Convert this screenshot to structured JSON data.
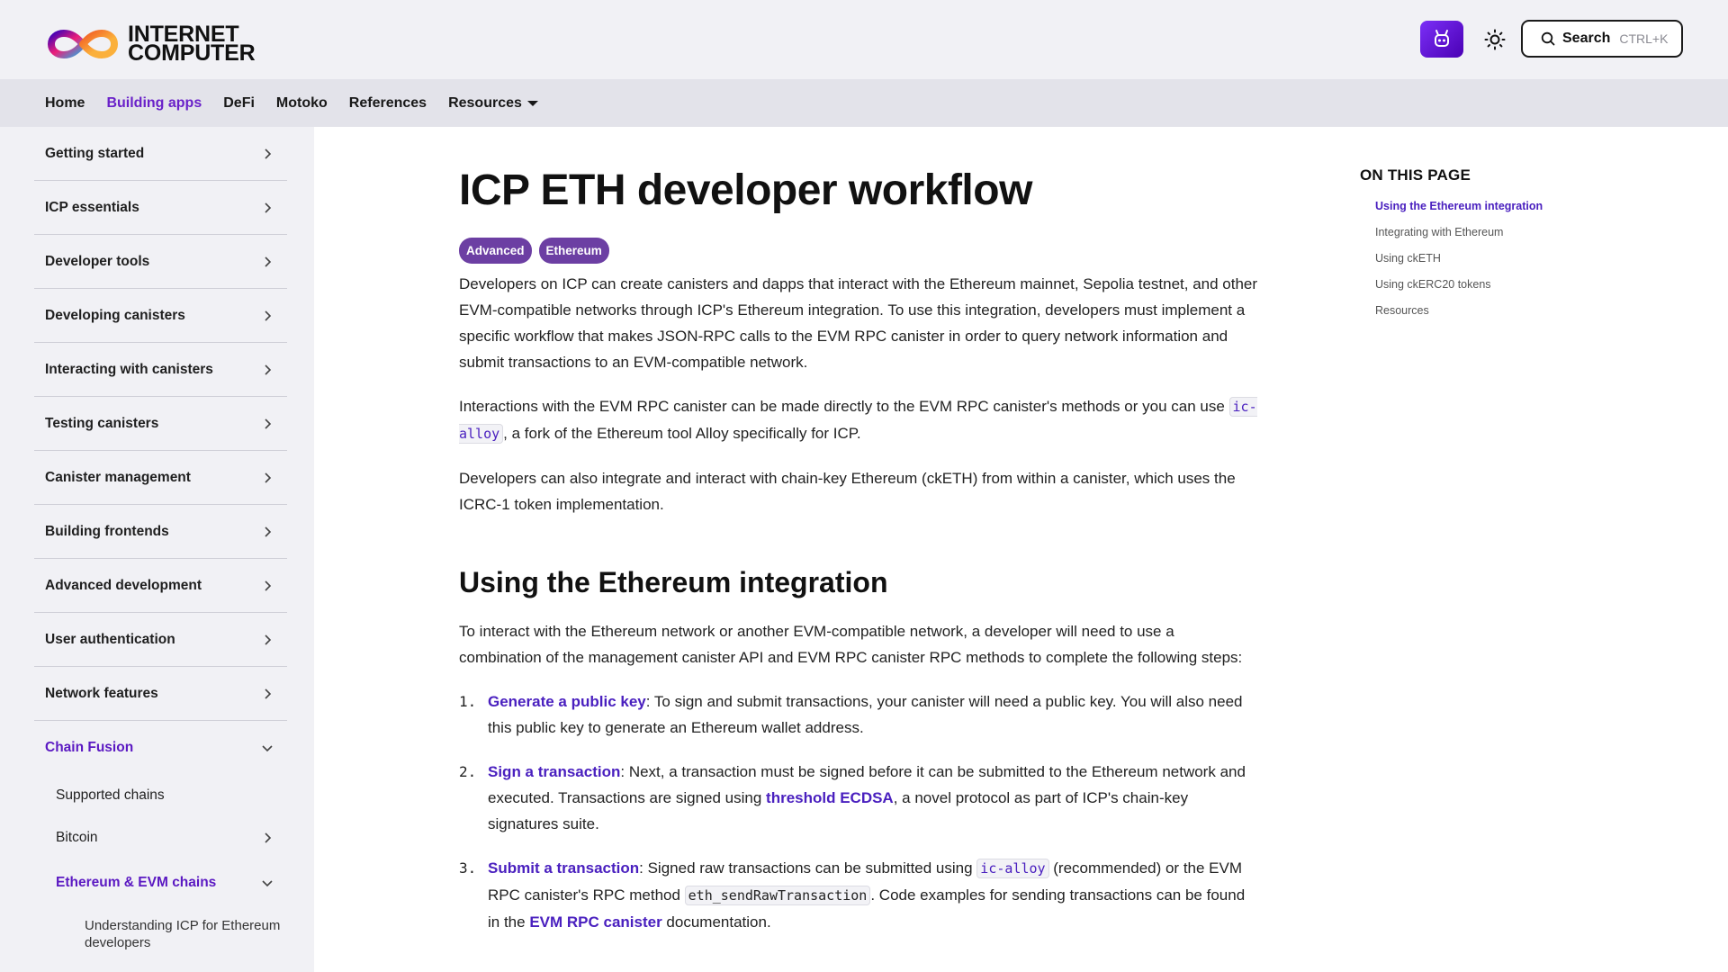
{
  "header": {
    "logo_text_line1": "INTERNET",
    "logo_text_line2": "COMPUTER",
    "search_label": "Search",
    "search_shortcut": "CTRL+K"
  },
  "nav": {
    "items": [
      "Home",
      "Building apps",
      "DeFi",
      "Motoko",
      "References",
      "Resources"
    ],
    "active": "Building apps"
  },
  "sidebar": {
    "items": [
      "Getting started",
      "ICP essentials",
      "Developer tools",
      "Developing canisters",
      "Interacting with canisters",
      "Testing canisters",
      "Canister management",
      "Building frontends",
      "Advanced development",
      "User authentication",
      "Network features"
    ],
    "open_section": "Chain Fusion",
    "sub_items": [
      "Supported chains",
      "Bitcoin",
      "Ethereum & EVM chains"
    ],
    "subsub_item": "Understanding ICP for Ethereum developers"
  },
  "main": {
    "title": "ICP ETH developer workflow",
    "tags": [
      "Advanced",
      "Ethereum"
    ],
    "para1": "Developers on ICP can create canisters and dapps that interact with the Ethereum mainnet, Sepolia testnet, and other EVM-compatible networks through ICP's Ethereum integration. To use this integration, developers must implement a specific workflow that makes JSON-RPC calls to the EVM RPC canister in order to query network information and submit transactions to an EVM-compatible network.",
    "para2_before": "Interactions with the EVM RPC canister can be made directly to the EVM RPC canister's methods or you can use ",
    "para2_code": "ic-alloy",
    "para2_after": ", a fork of the Ethereum tool Alloy specifically for ICP.",
    "para3": "Developers can also integrate and interact with chain-key Ethereum (ckETH) from within a canister, which uses the ICRC-1 token implementation.",
    "section_title": "Using the Ethereum integration",
    "para4": "To interact with the Ethereum network or another EVM-compatible network, a developer will need to use a combination of the management canister API and EVM RPC canister RPC methods to complete the following steps:",
    "steps": [
      {
        "num": "1.",
        "link": "Generate a public key",
        "text": ": To sign and submit transactions, your canister will need a public key. You will also need this public key to generate an Ethereum wallet address."
      },
      {
        "num": "2.",
        "link": "Sign a transaction",
        "text_before": ": Next, a transaction must be signed before it can be submitted to the Ethereum network and executed. Transactions are signed using ",
        "link2": "threshold ECDSA",
        "text_after": ", a novel protocol as part of ICP's chain-key signatures suite."
      },
      {
        "num": "3.",
        "link": "Submit a transaction",
        "text_before": ": Signed raw transactions can be submitted using ",
        "code1": "ic-alloy",
        "text_mid": " (recommended) or the EVM RPC canister's RPC method ",
        "code2": "eth_sendRawTransaction",
        "text_mid2": ". Code examples for sending transactions can be found in the ",
        "link2": "EVM RPC canister",
        "text_after": " documentation."
      }
    ]
  },
  "toc": {
    "title": "ON THIS PAGE",
    "items": [
      "Using the Ethereum integration",
      "Integrating with Ethereum",
      "Using ckETH",
      "Using ckERC20 tokens",
      "Resources"
    ]
  },
  "colors": {
    "accent": "#5b19c2",
    "link": "#4a20bf",
    "tag_bg": "#6c3fa3",
    "header_bg": "#f1f1f5",
    "nav_bg": "#e3e3ea"
  }
}
